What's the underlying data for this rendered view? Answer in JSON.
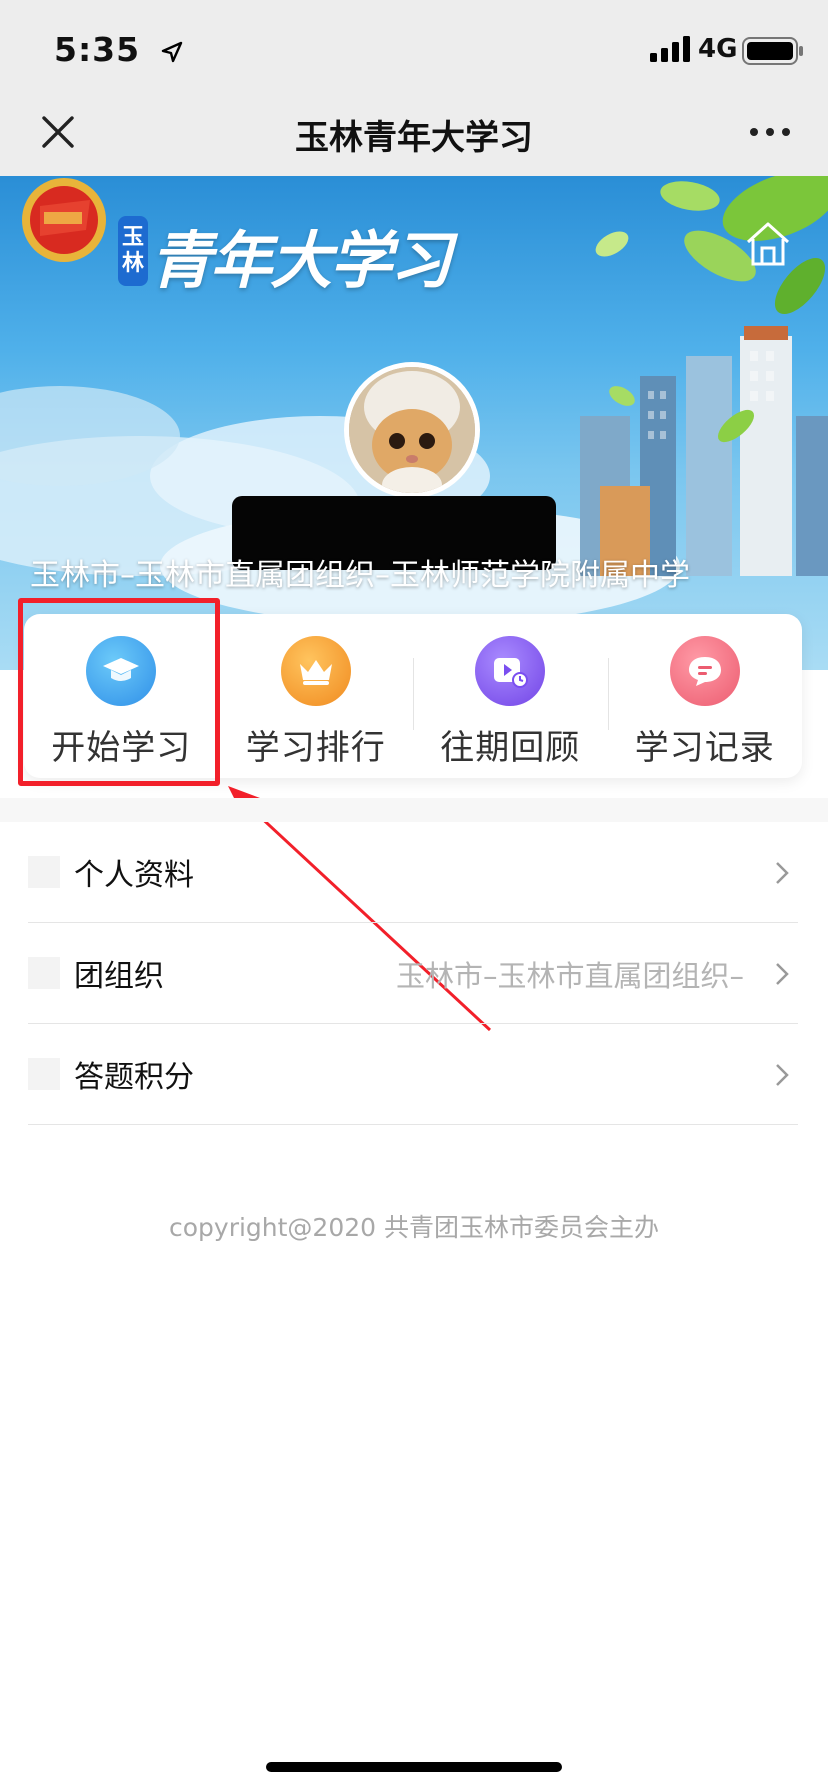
{
  "status_bar": {
    "time": "5:35",
    "network": "4G"
  },
  "nav": {
    "title": "玉林青年大学习",
    "close_icon": "close-icon",
    "more_icon": "more-icon"
  },
  "banner": {
    "brand_text": "青年大学习",
    "city_badge": [
      "玉",
      "林"
    ],
    "org_path": "玉林市–玉林市直属团组织–玉林师范学院附属中学",
    "home_icon": "home-icon"
  },
  "actions": [
    {
      "label": "开始学习",
      "icon": "graduation-cap-icon",
      "color": "#3aa3f0"
    },
    {
      "label": "学习排行",
      "icon": "crown-icon",
      "color": "#f39a2b"
    },
    {
      "label": "往期回顾",
      "icon": "video-replay-icon",
      "color": "#8a5cf0"
    },
    {
      "label": "学习记录",
      "icon": "chat-record-icon",
      "color": "#f06a7a"
    }
  ],
  "menu": [
    {
      "label": "个人资料",
      "value": ""
    },
    {
      "label": "团组织",
      "value": "玉林市–玉林市直属团组织–"
    },
    {
      "label": "答题积分",
      "value": ""
    }
  ],
  "footer": "copyright@2020 共青团玉林市委员会主办",
  "colors": {
    "highlight": "#f2202a",
    "nav_bg": "#ededed"
  }
}
